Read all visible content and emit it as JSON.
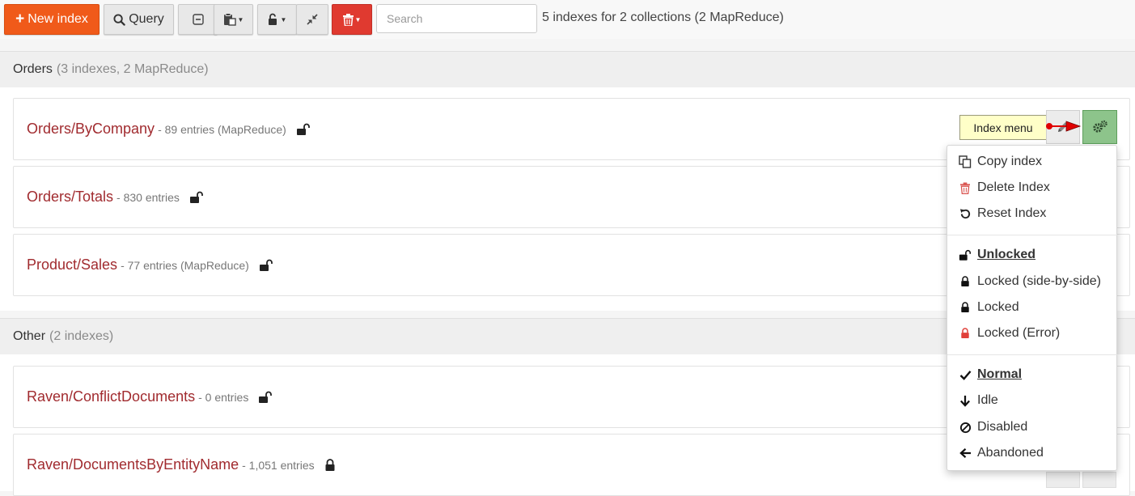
{
  "toolbar": {
    "new_index_label": "New index",
    "query_label": "Query",
    "search_placeholder": "Search",
    "summary": "5 indexes for 2 collections (2 MapReduce)"
  },
  "groups": [
    {
      "name": "Orders",
      "meta": "(3 indexes, 2 MapReduce)",
      "indexes": [
        {
          "name": "Orders/ByCompany",
          "meta": "- 89 entries (MapReduce)",
          "lock": "unlocked"
        },
        {
          "name": "Orders/Totals",
          "meta": "- 830 entries",
          "lock": "unlocked"
        },
        {
          "name": "Product/Sales",
          "meta": "- 77 entries (MapReduce)",
          "lock": "unlocked"
        }
      ]
    },
    {
      "name": "Other",
      "meta": "(2 indexes)",
      "indexes": [
        {
          "name": "Raven/ConflictDocuments",
          "meta": "- 0 entries",
          "lock": "unlocked"
        },
        {
          "name": "Raven/DocumentsByEntityName",
          "meta": "- 1,051 entries",
          "lock": "locked"
        }
      ]
    }
  ],
  "tooltip": "Index menu",
  "menu": {
    "actions": [
      "Copy index",
      "Delete Index",
      "Reset Index"
    ],
    "lock_modes": [
      "Unlocked",
      "Locked (side-by-side)",
      "Locked",
      "Locked (Error)"
    ],
    "priorities": [
      "Normal",
      "Idle",
      "Disabled",
      "Abandoned"
    ]
  },
  "colors": {
    "new_index_button": "#f05a1a",
    "delete_button": "#e03a30",
    "index_name": "#a12b2f",
    "gear_button": "#8dc48b",
    "tooltip_bg": "#ffffc8",
    "arrow": "#e00000"
  }
}
